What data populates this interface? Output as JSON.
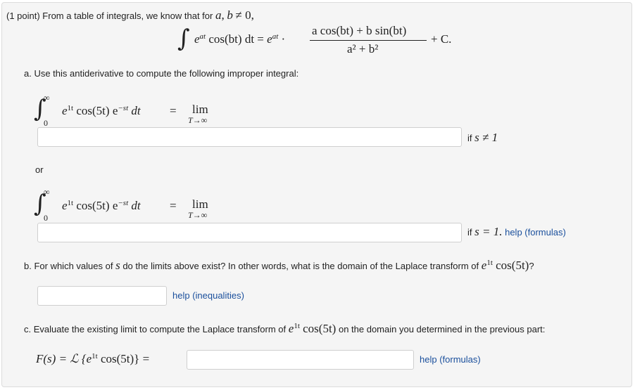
{
  "intro": {
    "text": "(1 point) From a table of integrals, we know that for",
    "cond_a": "a",
    "cond_comma": ",",
    "cond_b": "b",
    "cond_neq0": "≠ 0,"
  },
  "formula": {
    "integral_sign": "∫",
    "e": "e",
    "at": "at",
    "cos_bt_dt": "cos(bt) dt =",
    "dot": "·",
    "numerator": "a cos(bt) + b sin(bt)",
    "denominator": "a² + b²",
    "plus_c": "+ C."
  },
  "part_a": {
    "instruction": "a. Use this antiderivative to compute the following improper integral:",
    "upper_limit": "∞",
    "lower_limit": "0",
    "integrand_e": "e",
    "integrand_1t": "1t",
    "integrand_cos": "cos(5t) e",
    "integrand_st": "−st",
    "integrand_dt": "dt",
    "equals": "=",
    "lim": "lim",
    "lim_sub": "T→∞",
    "cond1_prefix": "if",
    "cond1": "s ≠ 1",
    "or": "or",
    "cond2_prefix": "if",
    "cond2": "s = 1.",
    "help": "help (formulas)",
    "input1_value": "",
    "input2_value": ""
  },
  "part_b": {
    "instruction_prefix": "b. For which values of",
    "s": "s",
    "instruction_mid": "do the limits above exist? In other words, what is the domain of the Laplace transform of",
    "func_e": "e",
    "func_1t": "1t",
    "func_cos": "cos(5t)",
    "question_mark": "?",
    "help": "help (inequalities)",
    "input_value": ""
  },
  "part_c": {
    "instruction_prefix": "c. Evaluate the existing limit to compute the Laplace transform of",
    "func_e": "e",
    "func_1t": "1t",
    "func_cos": "cos(5t)",
    "instruction_suffix": "on the domain you determined in the previous part:",
    "lhs_pre": "F(s) = ℒ {e",
    "lhs_1t": "1t",
    "lhs_post": "cos(5t)} =",
    "help": "help (formulas)",
    "input_value": ""
  }
}
